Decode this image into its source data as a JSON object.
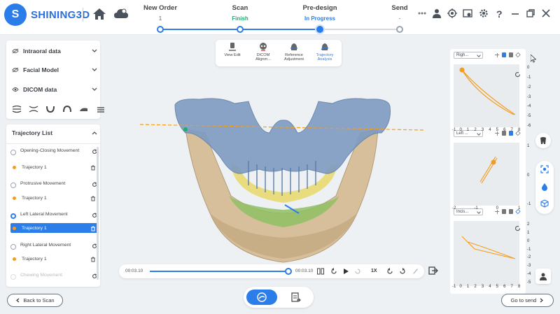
{
  "app": {
    "logo_text": "SHINING3D",
    "logo_mark": "S"
  },
  "workflow": {
    "steps": [
      {
        "title": "New Order",
        "status": "1"
      },
      {
        "title": "Scan",
        "status": "Finish"
      },
      {
        "title": "Pre-design",
        "status": "In Progress"
      },
      {
        "title": "Send",
        "status": "-"
      }
    ],
    "current_step": 2
  },
  "left_panel": {
    "data_items": [
      "Intraoral data",
      "Facial Model",
      "DICOM data"
    ],
    "trajectory_list_title": "Trajectory List",
    "movements": [
      {
        "label": "Opening-Closing Movement",
        "trajectories": [
          "Trajectory 1"
        ],
        "checked": false
      },
      {
        "label": "Protrusive Movement",
        "trajectories": [
          "Trajectory 1"
        ],
        "checked": false
      },
      {
        "label": "Left Lateral Movement",
        "trajectories": [
          "Trajectory 1"
        ],
        "checked": true
      },
      {
        "label": "Right Lateral Movement",
        "trajectories": [
          "Trajectory 1"
        ],
        "checked": false
      },
      {
        "label": "Chewing Movement",
        "trajectories": [],
        "checked": false
      }
    ],
    "selected_trajectory": "Left Lateral Movement / Trajectory 1"
  },
  "tool_tabs": [
    {
      "label": "View Edit",
      "icon": "view-edit-icon"
    },
    {
      "label": "DICOM Alignm...",
      "icon": "dicom-alignment-icon"
    },
    {
      "label": "Reference Adjustment",
      "icon": "reference-adjustment-icon"
    },
    {
      "label": "Trajectory Analysis",
      "icon": "trajectory-analysis-icon",
      "active": true
    }
  ],
  "playback": {
    "current_time": "00:03.10",
    "total_time": "00:03.10",
    "speed": "1X",
    "progress": 1.0
  },
  "charts": [
    {
      "view": "Righ...",
      "y_ticks": [
        "0",
        "-1",
        "-2",
        "-3",
        "-4",
        "-5",
        "-6"
      ],
      "x_ticks": [
        "-1",
        "0",
        "1",
        "2",
        "3",
        "4",
        "5",
        "6",
        "7",
        "8"
      ]
    },
    {
      "view": "Left ...",
      "y_ticks": [
        "1",
        "0",
        "-1"
      ],
      "x_ticks": [
        "-2",
        "-1",
        "0",
        "1"
      ]
    },
    {
      "view": "Incis...",
      "y_ticks": [
        "2",
        "1",
        "0",
        "-1",
        "-2",
        "-3",
        "-4",
        "-5"
      ],
      "x_ticks": [
        "-1",
        "0",
        "1",
        "2",
        "3",
        "4",
        "5",
        "6",
        "7",
        "8"
      ]
    }
  ],
  "footer": {
    "back_label": "Back to Scan",
    "next_label": "Go to send"
  },
  "colors": {
    "accent": "#2b7de9",
    "finish": "#1bb06e",
    "trajectory": "#f39c1f"
  }
}
